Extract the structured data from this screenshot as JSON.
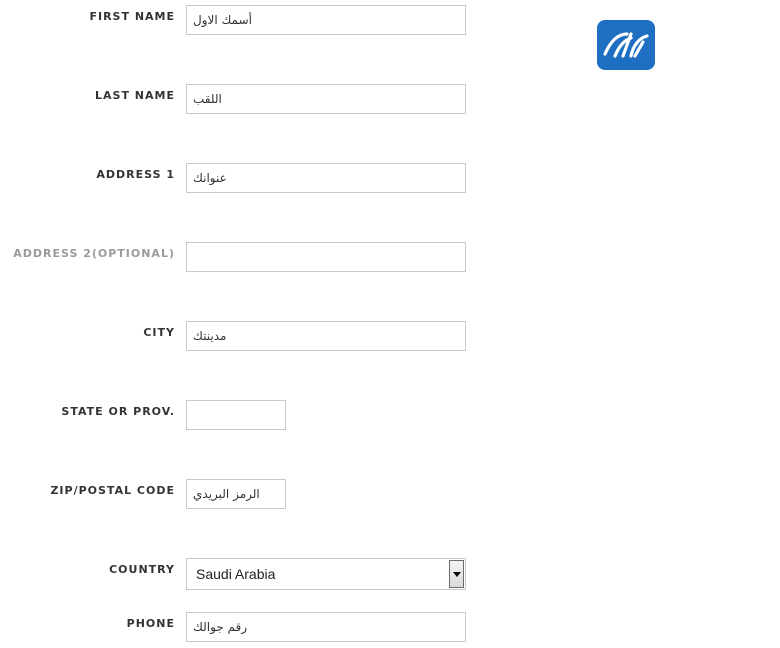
{
  "form": {
    "first_name": {
      "label": "FIRST NAME",
      "value": "أسمك الاول"
    },
    "last_name": {
      "label": "LAST NAME",
      "value": "اللقب"
    },
    "address1": {
      "label": "ADDRESS 1",
      "value": "عنوانك"
    },
    "address2": {
      "label": "ADDRESS 2(OPTIONAL)",
      "value": ""
    },
    "city": {
      "label": "CITY",
      "value": "مدينتك"
    },
    "state": {
      "label": "STATE OR PROV.",
      "value": ""
    },
    "zip": {
      "label": "ZIP/POSTAL CODE",
      "value": "الرمز البريدي"
    },
    "country": {
      "label": "COUNTRY",
      "value": "Saudi Arabia"
    },
    "phone": {
      "label": "PHONE",
      "value": "رقم جوالك"
    }
  },
  "logo": {
    "icon": "site-logo-icon",
    "color": "#1e6fc2"
  }
}
